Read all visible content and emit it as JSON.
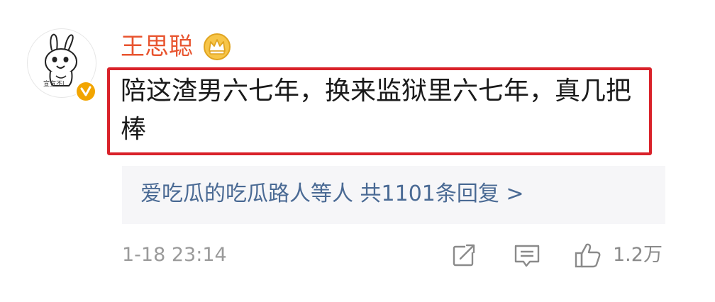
{
  "user": {
    "name": "王思聪",
    "avatar_caption": "宣宣不l"
  },
  "comment": {
    "text": "陪这渣男六七年，换来监狱里六七年，真几把棒"
  },
  "replies": {
    "summary": "爱吃瓜的吃瓜路人等人  共1101条回复 >"
  },
  "meta": {
    "timestamp": "1-18 23:14",
    "like_count": "1.2万"
  },
  "icons": {
    "share": "share-icon",
    "comment": "comment-icon",
    "like": "thumbs-up-icon",
    "verified": "verified-icon",
    "crown": "crown-icon"
  },
  "colors": {
    "username": "#e8542f",
    "highlight_border": "#d9222a",
    "reply_link": "#4a6a94",
    "muted": "#9a9a9a",
    "badge": "#f2a500"
  }
}
